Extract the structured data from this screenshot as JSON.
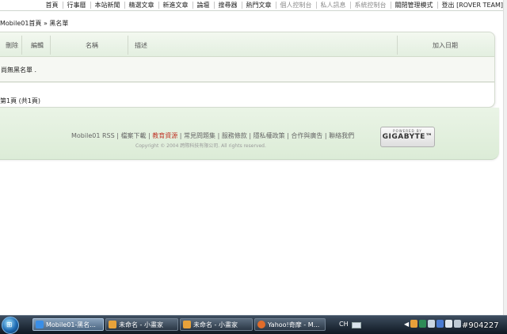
{
  "topnav": {
    "items": [
      "首頁",
      "行事曆",
      "本站新聞",
      "精選文章",
      "新進文章",
      "論壇",
      "搜尋器",
      "熱門文章",
      "個人控制台",
      "私人訊息",
      "系統控制台",
      "關閉管理模式",
      "登出 [ROVER TEAM]"
    ]
  },
  "breadcrumb": "Mobile01首頁 » 黑名單",
  "table": {
    "headers": [
      "刪除",
      "編輯",
      "名稱",
      "描述",
      "加入日期"
    ],
    "empty_message": "尚無黑名單 ."
  },
  "pager": "第1頁 (共1頁)",
  "footer": {
    "links": [
      "Mobile01 RSS",
      "檔案下載",
      "教育資源",
      "常見問題集",
      "服務條款",
      "隱私權政策",
      "合作與廣告",
      "聯絡我們"
    ],
    "copyright": "Copyright © 2004 跨際科技有限公司. All rights reserved.",
    "logo_top": "POWERED BY",
    "logo_main": "GIGABYTE™"
  },
  "taskbar": {
    "buttons": [
      "Mobile01-黑名...",
      "未命名 - 小畫家",
      "未命名 - 小畫家",
      "Yahoo!奇摩 - M..."
    ],
    "lang": "CH"
  },
  "watermark": "#904227",
  "colors": {
    "accent_green": "#e3efe0",
    "taskbar": "#1a2633",
    "link_red": "#c0392b"
  }
}
